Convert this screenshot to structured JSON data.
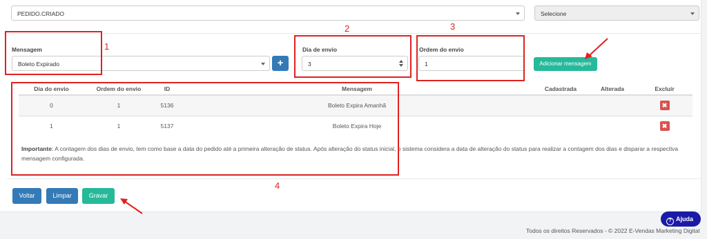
{
  "event_select": {
    "value": "PEDIDO.CRIADO"
  },
  "secondary_select": {
    "value": "Selecione"
  },
  "form": {
    "message_label": "Mensagem",
    "message_value": "Boleto Expirado",
    "add_plus": "+",
    "day_label": "Dia de envio",
    "day_value": "3",
    "order_label": "Ordem do envio",
    "order_value": "1",
    "add_button": "Adicionar mensagem"
  },
  "table": {
    "headers": [
      "Dia do envio",
      "Ordem do envio",
      "ID",
      "Mensagem",
      "Cadastrada",
      "Alterada",
      "Excluir"
    ],
    "rows": [
      {
        "day": "0",
        "order": "1",
        "id": "5136",
        "message": "Boleto Expira Amanhã",
        "created": "",
        "changed": "",
        "delete": "✖"
      },
      {
        "day": "1",
        "order": "1",
        "id": "5137",
        "message": "Boleto Expira Hoje",
        "created": "",
        "changed": "",
        "delete": "✖"
      }
    ]
  },
  "note": {
    "strong": "Importante",
    "text": ": A contagem dos dias de envio, tem como base a data do pedido até a primeira alteração de status. Após alteração do status inicial, o sistema considera a data de alteração do status para realizar a contagem dos dias e disparar a respectiva mensagem configurada."
  },
  "buttons": {
    "back": "Voltar",
    "clear": "Limpar",
    "save": "Gravar"
  },
  "annotations": {
    "n1": "1",
    "n2": "2",
    "n3": "3",
    "n4": "4"
  },
  "footer": "Todos os direitos Reservados - © 2022 E-Vendas Marketing Digital",
  "help": {
    "label": "Ajuda",
    "icon": "?"
  },
  "colors": {
    "primary": "#337ab7",
    "success": "#26b99a",
    "danger": "#d9534f",
    "annotation": "#e02020",
    "help": "#1a1aa6"
  }
}
